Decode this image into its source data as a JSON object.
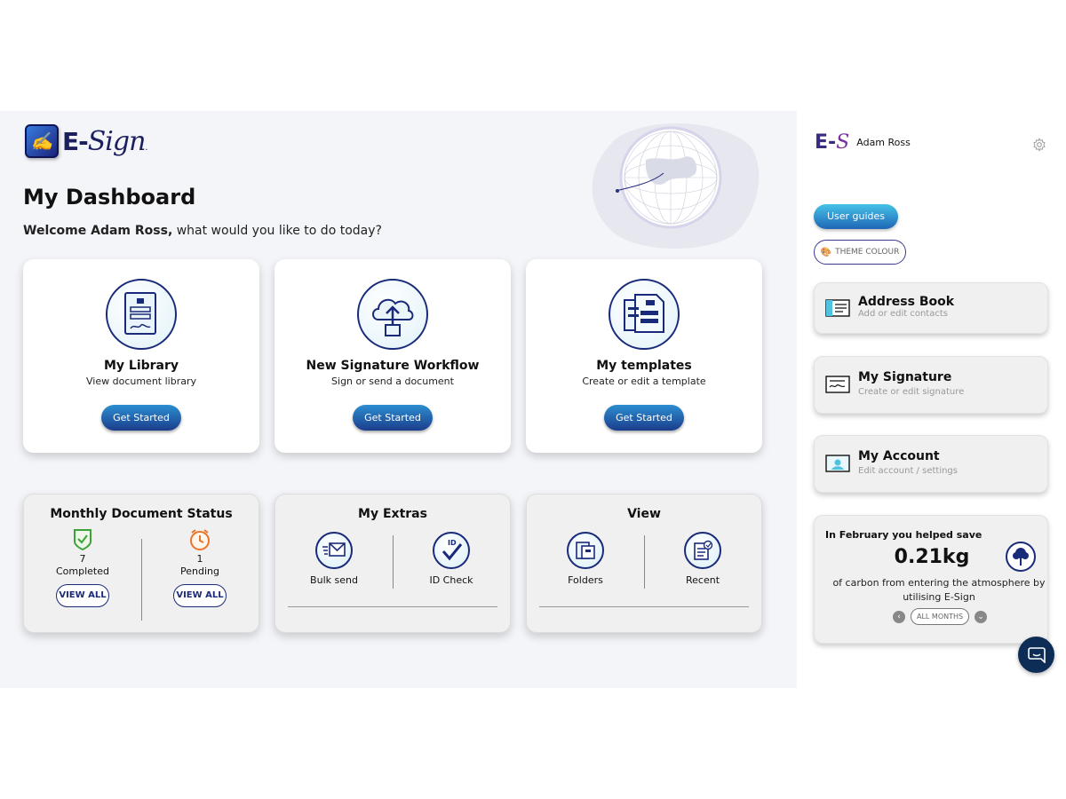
{
  "brand": {
    "name_prefix": "E-",
    "name_script": "Sign",
    "short_logo": "E-",
    "short_logo_script": "S"
  },
  "header": {
    "title": "My Dashboard",
    "welcome_name": "Welcome Adam Ross,",
    "welcome_rest": " what would you like to do today?"
  },
  "actions": [
    {
      "title": "My Library",
      "subtitle": "View document library",
      "button": "Get Started",
      "icon": "library-icon"
    },
    {
      "title": "New Signature Workflow",
      "subtitle": "Sign or send a document",
      "button": "Get Started",
      "icon": "cloud-upload-icon"
    },
    {
      "title": "My templates",
      "subtitle": "Create or edit a template",
      "button": "Get Started",
      "icon": "templates-icon"
    }
  ],
  "status": {
    "title": "Monthly Document Status",
    "completed": {
      "count": "7",
      "label": "Completed",
      "button": "VIEW ALL"
    },
    "pending": {
      "count": "1",
      "label": "Pending",
      "button": "VIEW ALL"
    }
  },
  "extras": {
    "title": "My Extras",
    "items": [
      {
        "label": "Bulk send"
      },
      {
        "label": "ID Check"
      }
    ]
  },
  "view": {
    "title": "View",
    "items": [
      {
        "label": "Folders"
      },
      {
        "label": "Recent"
      }
    ]
  },
  "sidebar": {
    "user_name": "Adam Ross",
    "user_guides": "User guides",
    "theme_colour": "THEME COLOUR",
    "cards": [
      {
        "title": "Address Book",
        "subtitle": "Add or edit contacts"
      },
      {
        "title": "My Signature",
        "subtitle": "Create or edit signature"
      },
      {
        "title": "My Account",
        "subtitle": "Edit account / settings"
      }
    ],
    "carbon": {
      "heading": "In February you helped save",
      "value": "0.21kg",
      "text": "of carbon from entering the atmosphere by utilising E-Sign",
      "filter": "ALL MONTHS"
    }
  },
  "colors": {
    "accent": "#1b3d8c",
    "accent_light": "#2c8ed0",
    "background": "#f4f5f9"
  }
}
